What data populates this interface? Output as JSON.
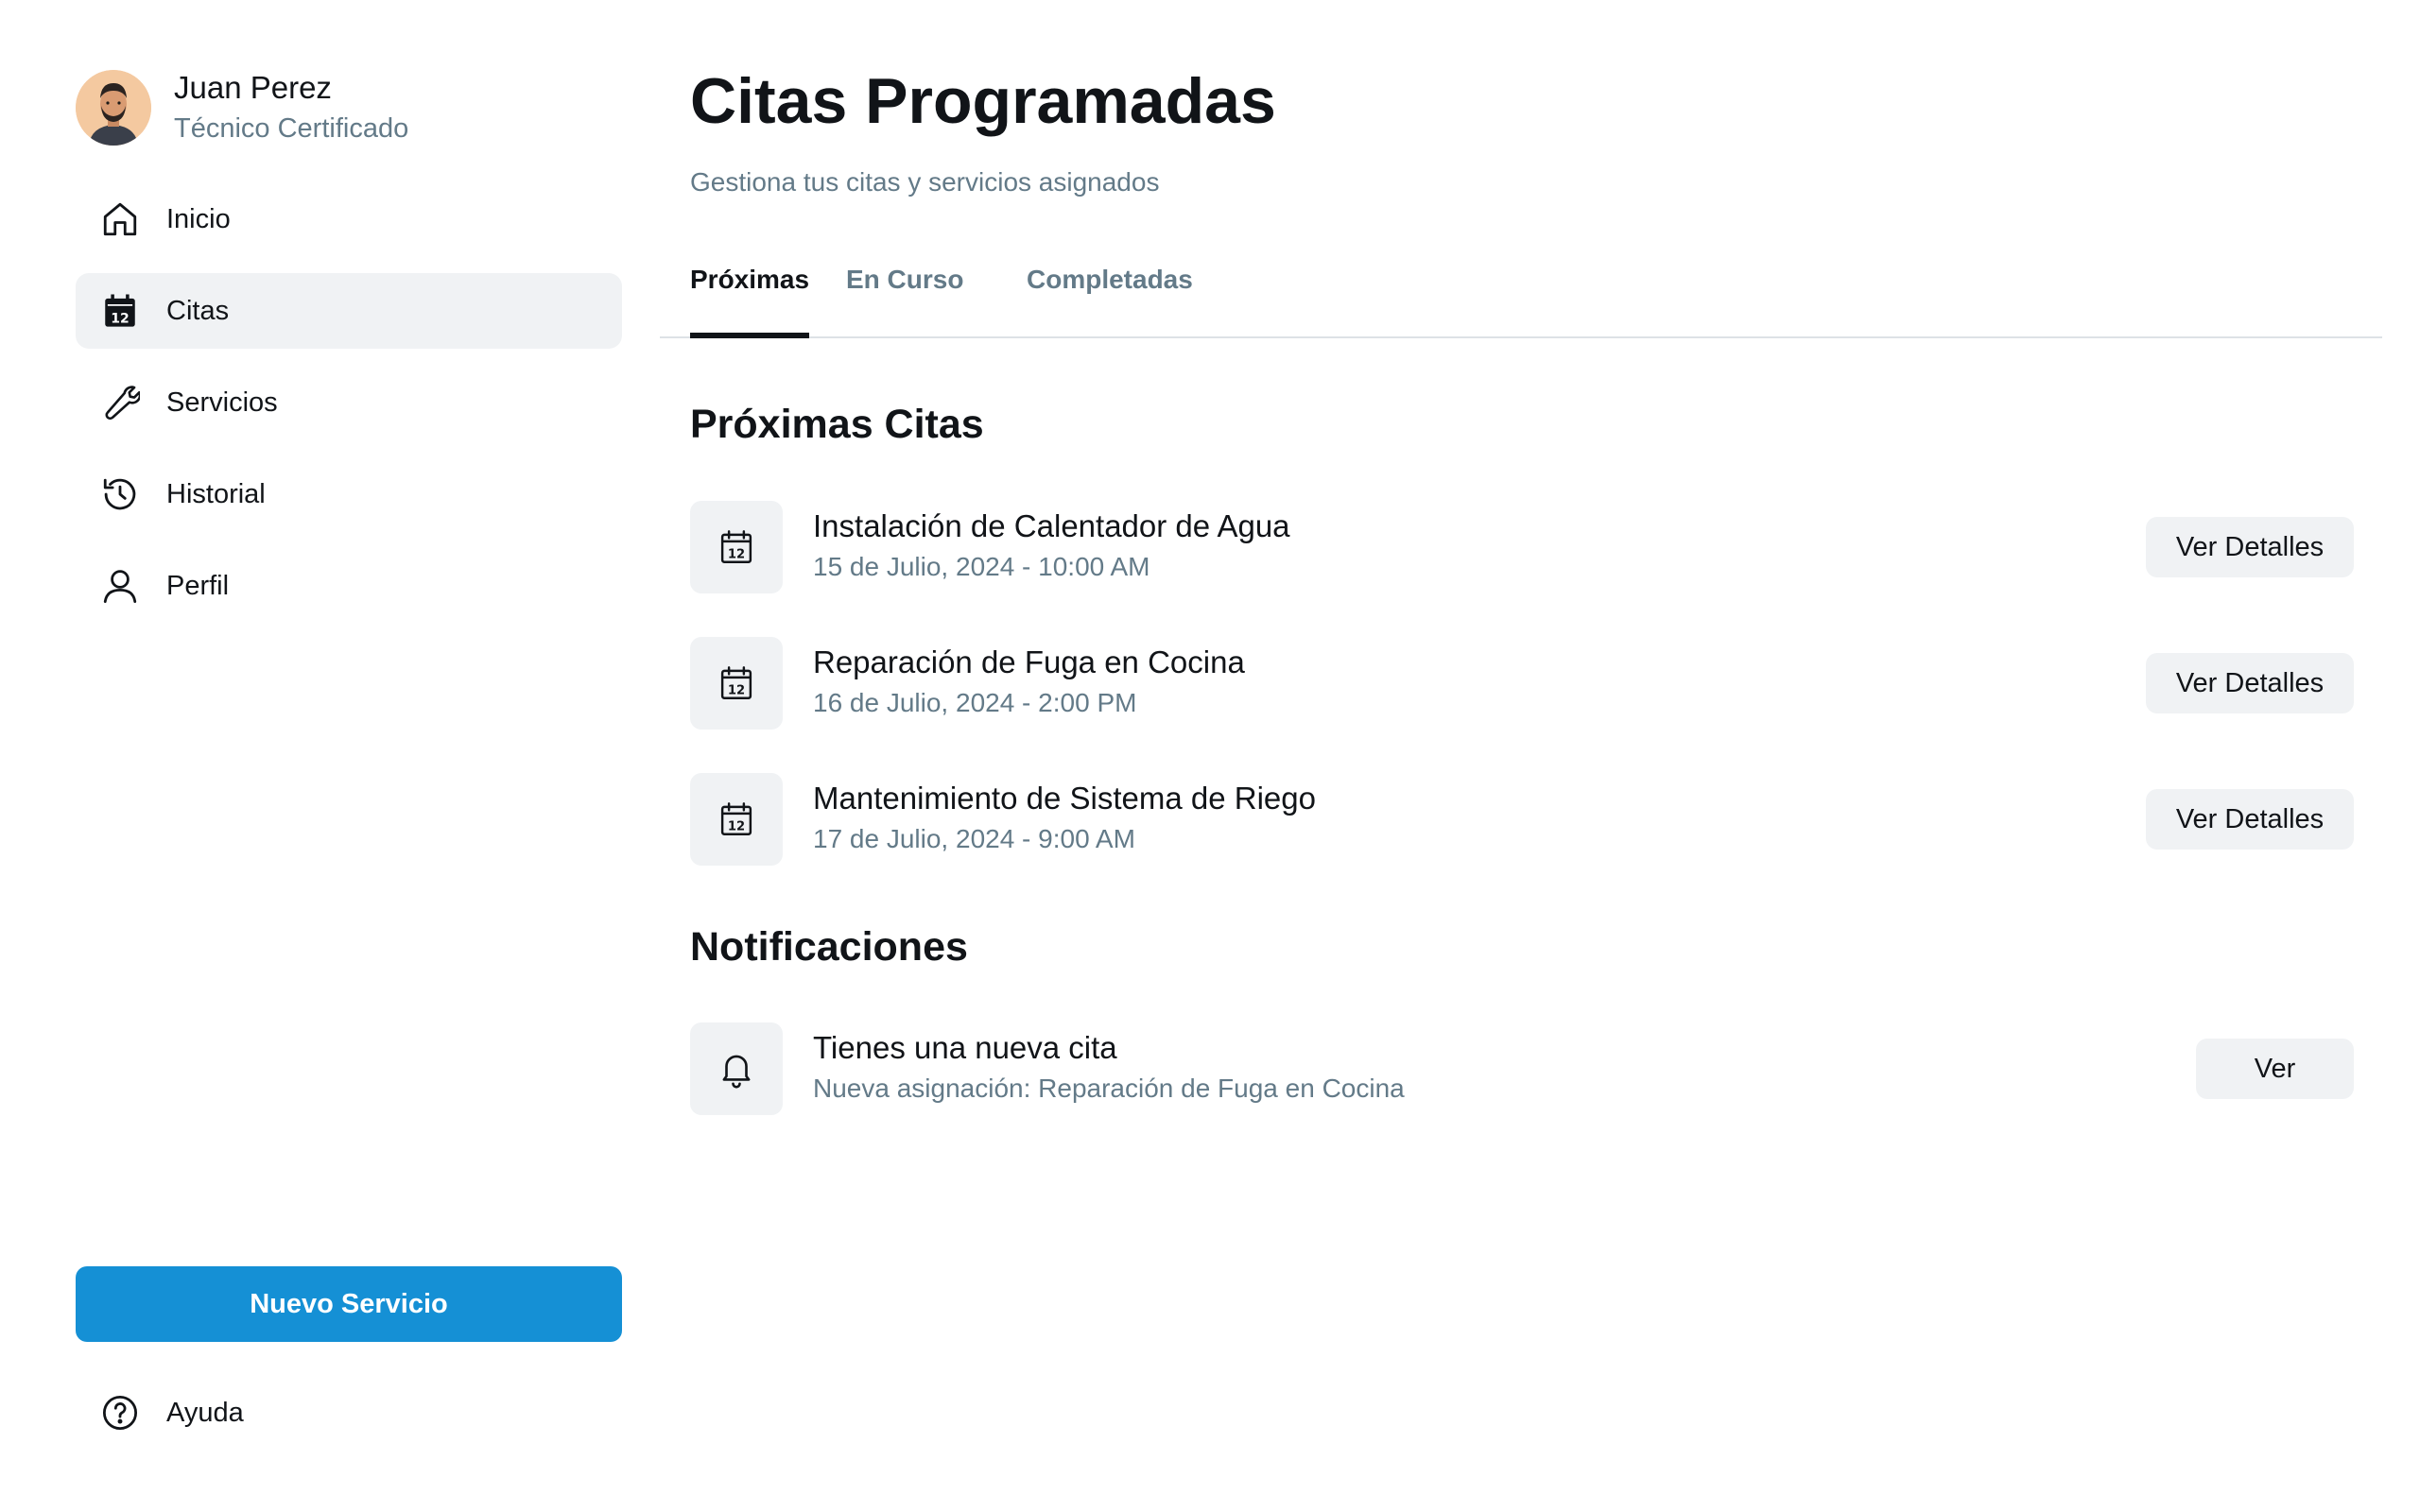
{
  "user": {
    "name": "Juan Perez",
    "role": "Técnico Certificado"
  },
  "sidebar": {
    "items": [
      {
        "label": "Inicio",
        "icon": "home-icon",
        "active": false
      },
      {
        "label": "Citas",
        "icon": "calendar-icon",
        "active": true
      },
      {
        "label": "Servicios",
        "icon": "wrench-icon",
        "active": false
      },
      {
        "label": "Historial",
        "icon": "history-icon",
        "active": false
      },
      {
        "label": "Perfil",
        "icon": "user-icon",
        "active": false
      }
    ],
    "new_service_label": "Nuevo Servicio",
    "help_label": "Ayuda"
  },
  "header": {
    "title": "Citas Programadas",
    "subtitle": "Gestiona tus citas y servicios asignados"
  },
  "tabs": [
    {
      "label": "Próximas",
      "active": true
    },
    {
      "label": "En Curso",
      "active": false
    },
    {
      "label": "Completadas",
      "active": false
    }
  ],
  "upcoming": {
    "title": "Próximas Citas",
    "items": [
      {
        "title": "Instalación de Calentador de Agua",
        "datetime": "15 de Julio, 2024 - 10:00 AM",
        "button": "Ver Detalles"
      },
      {
        "title": "Reparación de Fuga en Cocina",
        "datetime": "16 de Julio, 2024 - 2:00 PM",
        "button": "Ver Detalles"
      },
      {
        "title": "Mantenimiento de Sistema de Riego",
        "datetime": "17 de Julio, 2024 - 9:00 AM",
        "button": "Ver Detalles"
      }
    ]
  },
  "notifications": {
    "title": "Notificaciones",
    "items": [
      {
        "title": "Tienes una nueva cita",
        "detail": "Nueva asignación: Reparación de Fuga en Cocina",
        "button": "Ver"
      }
    ]
  },
  "colors": {
    "accent": "#1590d5",
    "muted_text": "#637a88",
    "surface": "#f0f2f4"
  }
}
